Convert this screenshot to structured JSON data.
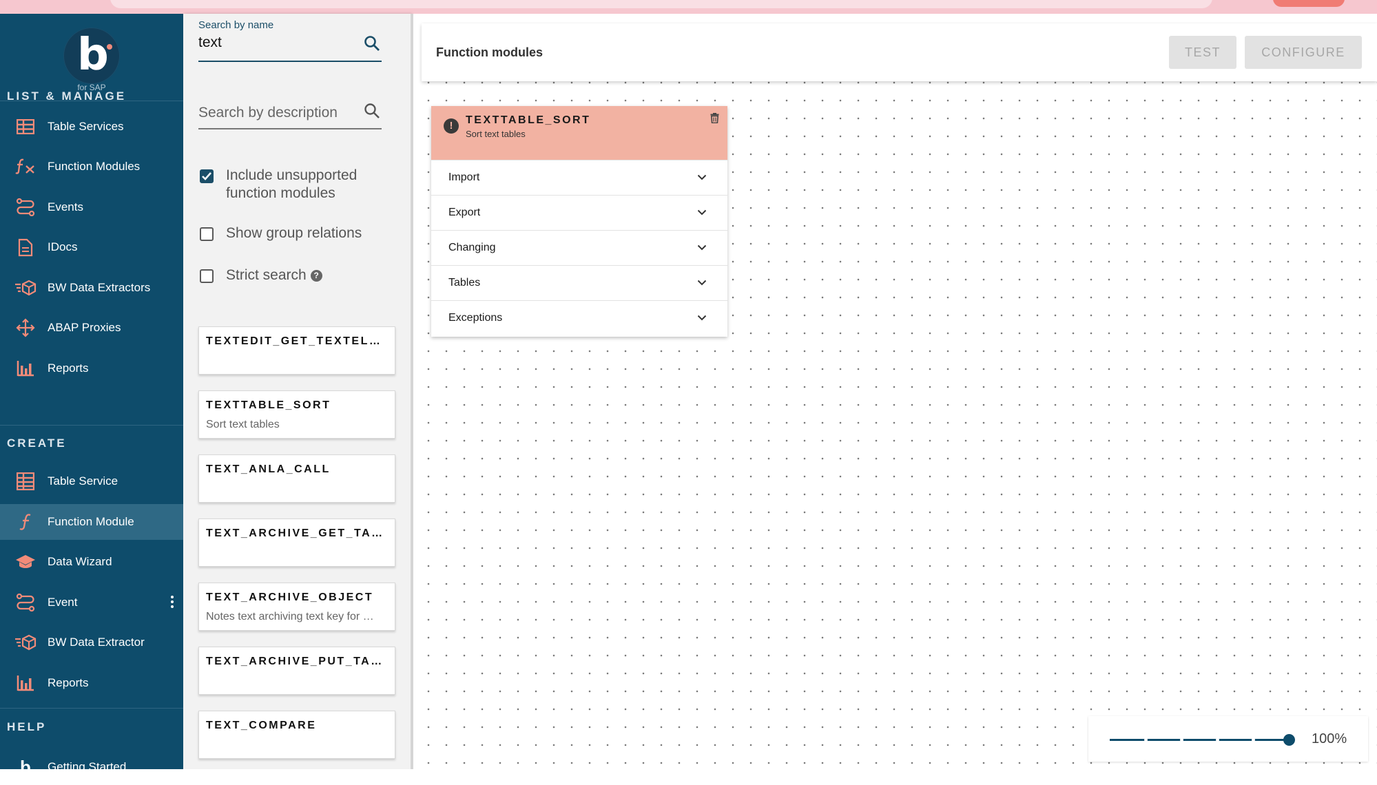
{
  "brand": {
    "sub_label": "for SAP"
  },
  "sidebar": {
    "list_manage_title": "LIST & MANAGE",
    "list_manage_items": [
      {
        "label": "Table Services",
        "icon": "table-icon"
      },
      {
        "label": "Function Modules",
        "icon": "function-icon"
      },
      {
        "label": "Events",
        "icon": "events-icon"
      },
      {
        "label": "IDocs",
        "icon": "document-icon"
      },
      {
        "label": "BW Data Extractors",
        "icon": "cube-extract-icon"
      },
      {
        "label": "ABAP Proxies",
        "icon": "proxy-arrows-icon"
      },
      {
        "label": "Reports",
        "icon": "bar-chart-icon"
      }
    ],
    "create_title": "CREATE",
    "create_items": [
      {
        "label": "Table Service",
        "icon": "table-icon"
      },
      {
        "label": "Function Module",
        "icon": "function-icon",
        "active": true
      },
      {
        "label": "Data Wizard",
        "icon": "wizard-hat-icon"
      },
      {
        "label": "Event",
        "icon": "events-icon"
      },
      {
        "label": "BW Data Extractor",
        "icon": "cube-extract-icon"
      },
      {
        "label": "Reports",
        "icon": "bar-chart-icon"
      }
    ],
    "help_title": "HELP",
    "help_items": [
      {
        "label": "Getting Started",
        "icon": "brand-b-icon"
      }
    ]
  },
  "search": {
    "name_label": "Search by name",
    "name_value": "text",
    "description_placeholder": "Search by description",
    "include_unsupported_label": "Include unsupported function modules",
    "include_unsupported_checked": true,
    "show_group_relations_label": "Show group relations",
    "show_group_relations_checked": false,
    "strict_search_label": "Strict search",
    "strict_search_checked": false,
    "help_glyph": "?"
  },
  "results": [
    {
      "name": "TEXTEDIT_GET_TEXTEL…",
      "description": ""
    },
    {
      "name": "TEXTTABLE_SORT",
      "description": "Sort text tables"
    },
    {
      "name": "TEXT_ANLA_CALL",
      "description": ""
    },
    {
      "name": "TEXT_ARCHIVE_GET_TA…",
      "description": ""
    },
    {
      "name": "TEXT_ARCHIVE_OBJECT",
      "description": "Notes text archiving text key for …"
    },
    {
      "name": "TEXT_ARCHIVE_PUT_TA…",
      "description": ""
    },
    {
      "name": "TEXT_COMPARE",
      "description": ""
    }
  ],
  "canvas": {
    "title": "Function modules",
    "test_label": "TEST",
    "configure_label": "CONFIGURE"
  },
  "node": {
    "warning_glyph": "!",
    "name": "TEXTTABLE_SORT",
    "description": "Sort text tables",
    "sections": [
      "Import",
      "Export",
      "Changing",
      "Tables",
      "Exceptions"
    ]
  },
  "zoom": {
    "level": 1.0,
    "label": "100%"
  },
  "colors": {
    "sidebar_bg": "#0e4c6b",
    "accent": "#f07c74",
    "node_header": "#f2b2a2",
    "active_item": "#2f6985"
  }
}
